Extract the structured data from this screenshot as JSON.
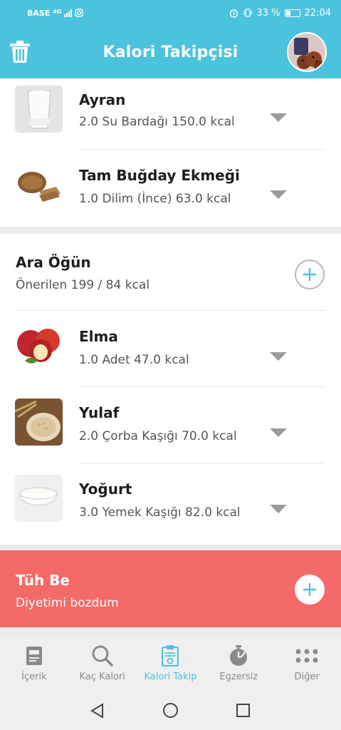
{
  "statusbar": {
    "carrier": "BASE",
    "network": "4G",
    "battery": "33 %",
    "time": "22:04"
  },
  "appbar": {
    "title": "Kalori Takipçisi"
  },
  "breakfast_items": [
    {
      "name": "Ayran",
      "detail": "2.0 Su Bardağı 150.0 kcal",
      "icon": "glass-of-ayran"
    },
    {
      "name": "Tam Buğday Ekmeği",
      "detail": "1.0 Dilim (İnce) 63.0 kcal",
      "icon": "whole-wheat-bread"
    }
  ],
  "snack": {
    "title": "Ara Öğün",
    "subtitle": "Önerilen 199 / 84 kcal",
    "items": [
      {
        "name": "Elma",
        "detail": "1.0 Adet 47.0 kcal",
        "icon": "apple"
      },
      {
        "name": "Yulaf",
        "detail": "2.0 Çorba Kaşığı 70.0 kcal",
        "icon": "oats"
      },
      {
        "name": "Yoğurt",
        "detail": "3.0 Yemek Kaşığı 82.0 kcal",
        "icon": "yogurt-bowl"
      }
    ]
  },
  "tuhbe": {
    "title": "Tüh Be",
    "subtitle": "Diyetimi bozdum"
  },
  "bottom_nav": [
    {
      "label": "İçerik",
      "icon": "book-icon",
      "active": false
    },
    {
      "label": "Kaç Kalori",
      "icon": "search-icon",
      "active": false
    },
    {
      "label": "Kalori Takip",
      "icon": "clipboard-icon",
      "active": true
    },
    {
      "label": "Egzersiz",
      "icon": "stopwatch-icon",
      "active": false
    },
    {
      "label": "Diğer",
      "icon": "dots-grid-icon",
      "active": false
    }
  ],
  "colors": {
    "accent": "#4cc3dc",
    "tuhbe_bg": "#f36a68",
    "inactive": "#8a8a8a"
  }
}
